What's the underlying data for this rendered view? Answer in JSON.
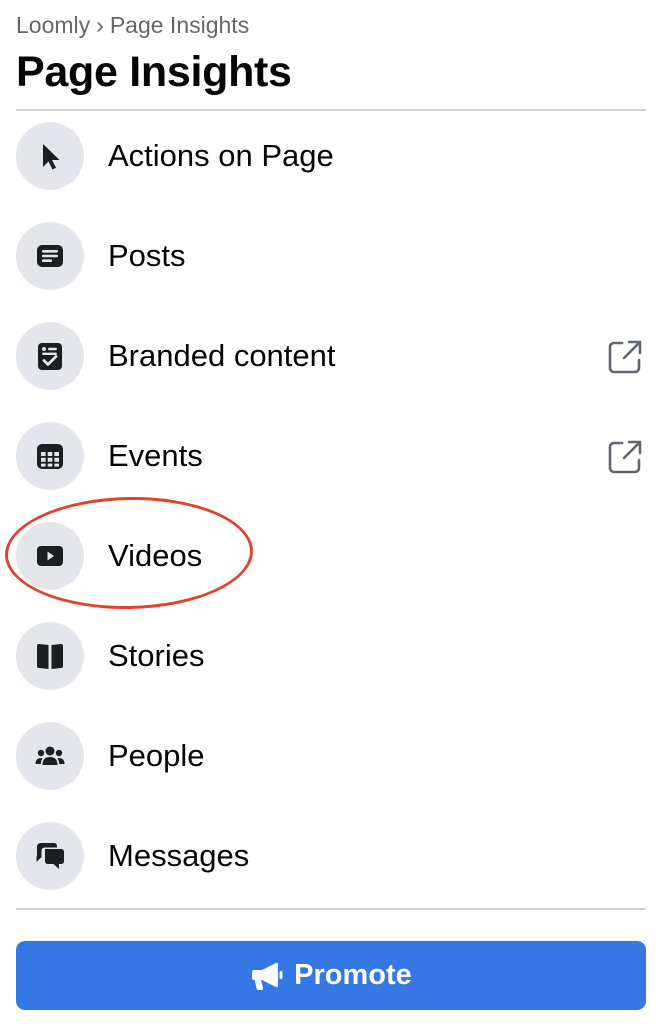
{
  "breadcrumb": {
    "parent": "Loomly",
    "separator": "›",
    "current": "Page Insights"
  },
  "page_title": "Page Insights",
  "menu": {
    "items": [
      {
        "label": "Actions on Page",
        "icon": "cursor-icon"
      },
      {
        "label": "Posts",
        "icon": "posts-icon"
      },
      {
        "label": "Branded content",
        "icon": "branded-content-icon",
        "external_icon": "external-link-icon"
      },
      {
        "label": "Events",
        "icon": "calendar-icon",
        "external_icon": "external-link-icon"
      },
      {
        "label": "Videos",
        "icon": "video-play-icon",
        "highlighted": true
      },
      {
        "label": "Stories",
        "icon": "book-icon"
      },
      {
        "label": "People",
        "icon": "people-icon"
      },
      {
        "label": "Messages",
        "icon": "chat-bubbles-icon"
      }
    ]
  },
  "promote_button": {
    "label": "Promote",
    "icon": "megaphone-icon"
  },
  "colors": {
    "accent": "#3578e5",
    "highlight": "#e0442f",
    "icon_bg": "#e4e6eb",
    "muted_text": "#65676b"
  }
}
